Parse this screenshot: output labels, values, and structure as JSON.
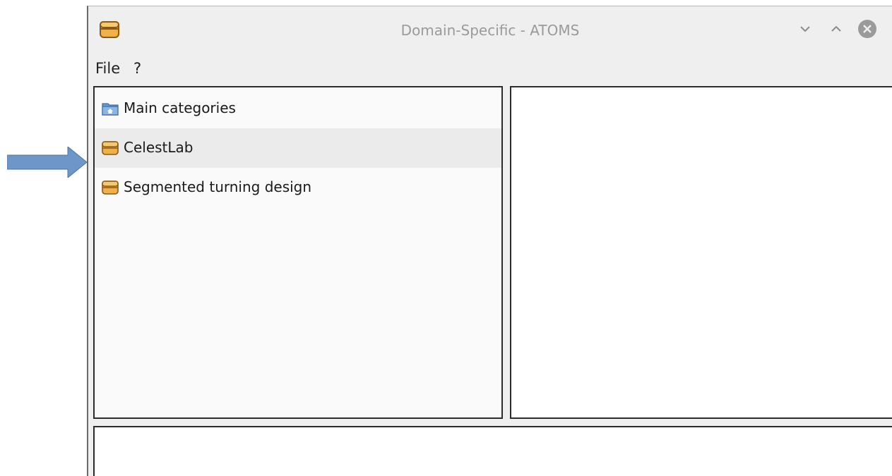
{
  "window": {
    "title": "Domain-Specific - ATOMS"
  },
  "menu": {
    "file": "File",
    "help": "?"
  },
  "tree": {
    "items": [
      {
        "label": "Main categories",
        "icon": "folder-home-icon",
        "selected": false
      },
      {
        "label": "CelestLab",
        "icon": "package-icon",
        "selected": true
      },
      {
        "label": "Segmented turning design",
        "icon": "package-icon",
        "selected": false
      }
    ]
  },
  "colors": {
    "arrow": "#6f96c8",
    "package": "#e6a43a",
    "folder": "#5b8ec9",
    "selection": "#ebebeb"
  }
}
